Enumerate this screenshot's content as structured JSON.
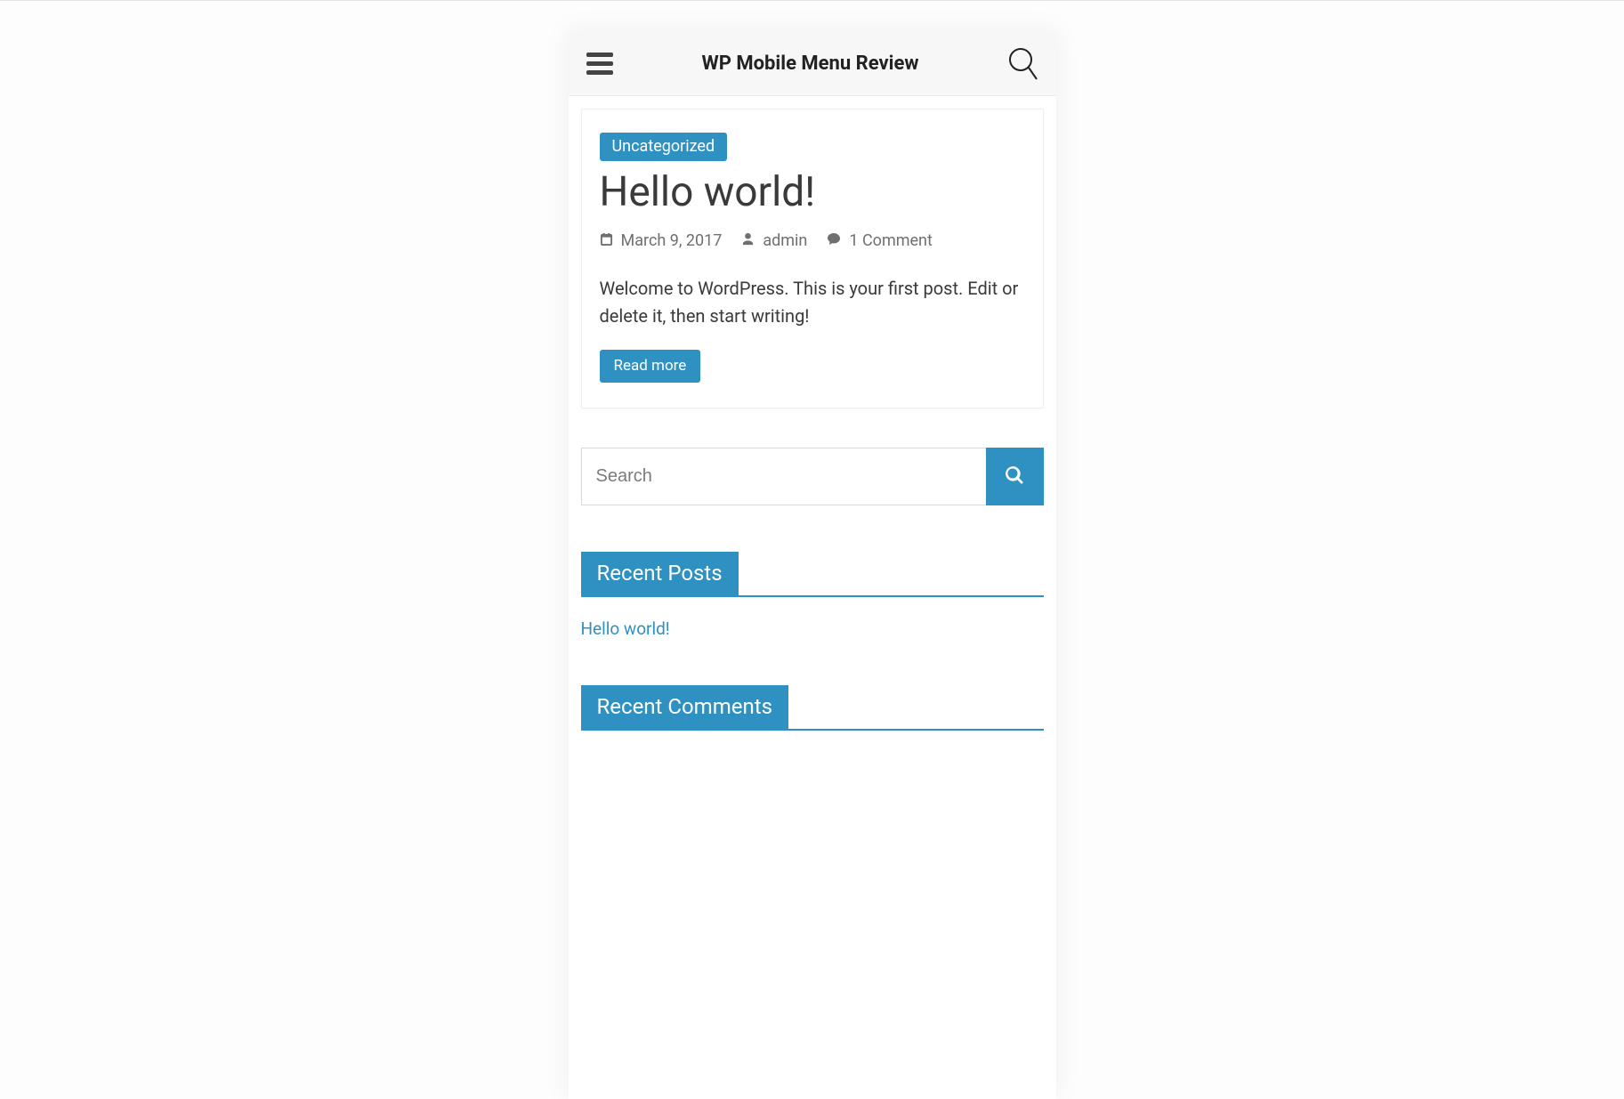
{
  "header": {
    "site_title": "WP Mobile Menu Review"
  },
  "post": {
    "category": "Uncategorized",
    "title": "Hello world!",
    "date": "March 9, 2017",
    "author": "admin",
    "comments": "1 Comment",
    "excerpt": "Welcome to WordPress. This is your first post. Edit or delete it, then start writing!",
    "read_more": "Read more"
  },
  "search": {
    "placeholder": "Search"
  },
  "widgets": {
    "recent_posts": {
      "title": "Recent Posts",
      "items": [
        {
          "label": "Hello world!"
        }
      ]
    },
    "recent_comments": {
      "title": "Recent Comments"
    }
  },
  "colors": {
    "accent": "#2e91c2"
  }
}
